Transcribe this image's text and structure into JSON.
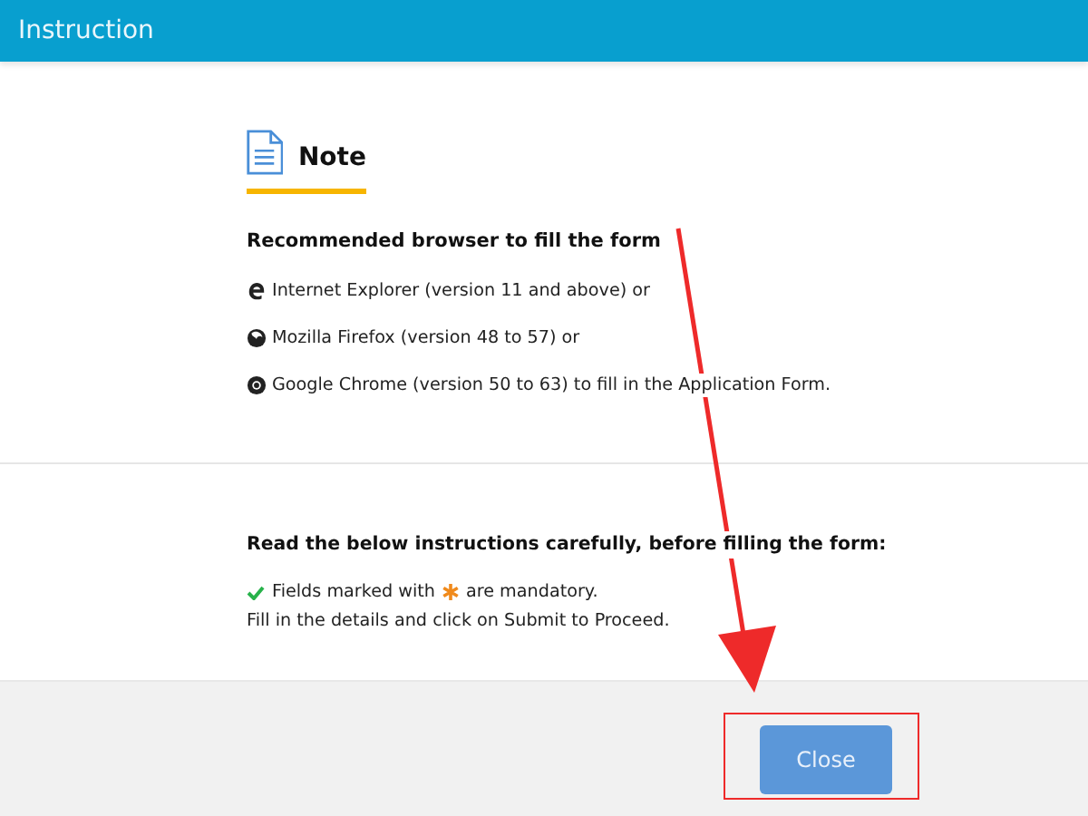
{
  "header": {
    "title": "Instruction"
  },
  "note": {
    "title": "Note"
  },
  "browsers": {
    "heading": "Recommended browser to fill the form",
    "items": [
      {
        "kind": "ie",
        "text": "Internet Explorer (version 11 and above) or"
      },
      {
        "kind": "firefox",
        "text": "Mozilla Firefox (version 48 to 57) or"
      },
      {
        "kind": "chrome",
        "text": "Google Chrome (version 50 to 63) to fill in the Application Form."
      }
    ]
  },
  "instructions": {
    "heading": "Read the below instructions carefully, before filling the form:",
    "mandatory_before": "Fields marked with",
    "mandatory_after": "are mandatory.",
    "details": "Fill in the details and click on Submit to Proceed."
  },
  "footer": {
    "button": "Close"
  }
}
